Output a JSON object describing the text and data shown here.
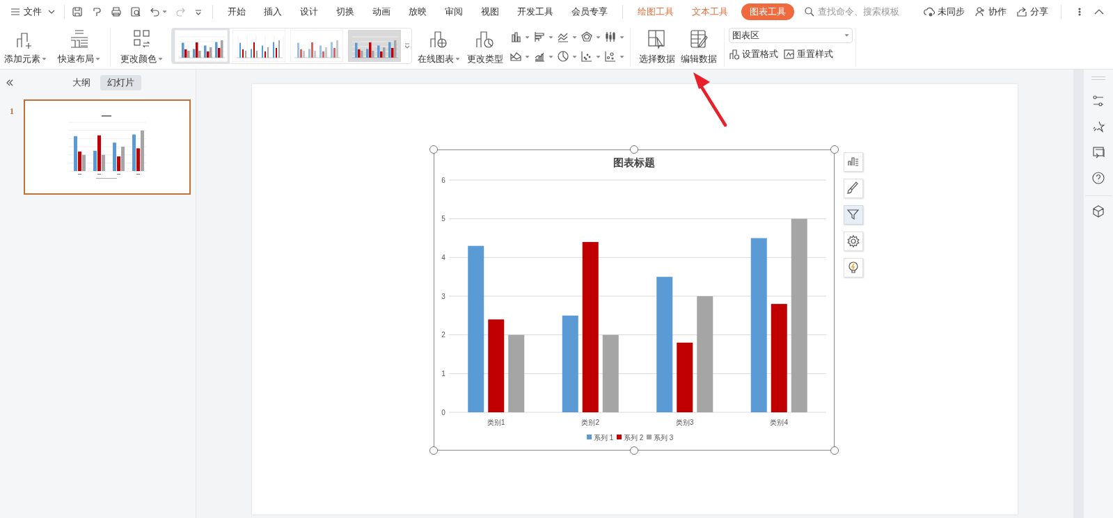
{
  "menu_bar": {
    "file_menu": "文件",
    "tabs": [
      {
        "label": "开始",
        "kind": "main",
        "selected": false
      },
      {
        "label": "插入",
        "kind": "main",
        "selected": false
      },
      {
        "label": "设计",
        "kind": "main",
        "selected": false
      },
      {
        "label": "切换",
        "kind": "main",
        "selected": false
      },
      {
        "label": "动画",
        "kind": "main",
        "selected": false
      },
      {
        "label": "放映",
        "kind": "main",
        "selected": false
      },
      {
        "label": "审阅",
        "kind": "main",
        "selected": false
      },
      {
        "label": "视图",
        "kind": "main",
        "selected": false
      },
      {
        "label": "开发工具",
        "kind": "main",
        "selected": false
      },
      {
        "label": "会员专享",
        "kind": "main",
        "selected": false
      },
      {
        "label": "绘图工具",
        "kind": "context",
        "selected": false
      },
      {
        "label": "文本工具",
        "kind": "context",
        "selected": false
      },
      {
        "label": "图表工具",
        "kind": "context",
        "selected": true
      }
    ],
    "search": {
      "placeholder": "查找命令、搜索模板"
    },
    "actions": [
      {
        "label": "未同步",
        "kind": "sync"
      },
      {
        "label": "协作",
        "kind": "collaborate"
      },
      {
        "label": "分享",
        "kind": "share"
      }
    ]
  },
  "ribbon": {
    "left_buttons": [
      {
        "label": "添加元素",
        "kind": "add"
      },
      {
        "label": "快速布局",
        "kind": "layout"
      },
      {
        "label": "更改颜色",
        "kind": "colors"
      }
    ],
    "chart_styles": [
      {
        "kind": "plain",
        "selected": true
      },
      {
        "kind": "gridded",
        "selected": false
      },
      {
        "kind": "striped",
        "selected": false
      },
      {
        "kind": "shaded",
        "selected": false
      }
    ],
    "type_buttons": [
      {
        "label": "在线图表",
        "kind": "online"
      },
      {
        "label": "更改类型",
        "kind": "change"
      }
    ],
    "chart_types": [
      {
        "kind": "column"
      },
      {
        "kind": "bar"
      },
      {
        "kind": "line"
      },
      {
        "kind": "radar"
      },
      {
        "kind": "stock"
      },
      {
        "kind": "area"
      },
      {
        "kind": "combo"
      },
      {
        "kind": "pie"
      },
      {
        "kind": "scatter"
      },
      {
        "kind": "bubble"
      }
    ],
    "data_buttons": [
      {
        "label": "选择数据",
        "kind": "select"
      },
      {
        "label": "编辑数据",
        "kind": "edit"
      }
    ],
    "element_select": {
      "value": "图表区"
    },
    "format_buttons": [
      {
        "label": "设置格式",
        "kind": "format"
      },
      {
        "label": "重置样式",
        "kind": "reset"
      }
    ]
  },
  "panel": {
    "tabs": [
      {
        "label": "大纲",
        "selected": false
      },
      {
        "label": "幻灯片",
        "selected": true
      }
    ],
    "slides": [
      {
        "number": "1",
        "selected": true
      }
    ]
  },
  "chart": {
    "chart_data": {
      "type": "bar",
      "title": "图表标题",
      "categories": [
        "类别1",
        "类别2",
        "类别3",
        "类别4"
      ],
      "series": [
        {
          "name": "系列 1",
          "color": "#5b9bd5",
          "values": [
            4.3,
            2.5,
            3.5,
            4.5
          ]
        },
        {
          "name": "系列 2",
          "color": "#c00000",
          "values": [
            2.4,
            4.4,
            1.8,
            2.8
          ]
        },
        {
          "name": "系列 3",
          "color": "#a5a5a5",
          "values": [
            2,
            2,
            3,
            5
          ]
        }
      ],
      "ylim": [
        0,
        6
      ],
      "yticks": [
        {
          "value": 0,
          "label": "0"
        },
        {
          "value": 1,
          "label": "1"
        },
        {
          "value": 2,
          "label": "2"
        },
        {
          "value": 3,
          "label": "3"
        },
        {
          "value": 4,
          "label": "4"
        },
        {
          "value": 5,
          "label": "5"
        },
        {
          "value": 6,
          "label": "6"
        }
      ],
      "grid": true,
      "legend": true
    }
  },
  "chart_tools": [
    {
      "kind": "elements",
      "selected": false
    },
    {
      "kind": "style",
      "selected": false
    },
    {
      "kind": "filter",
      "selected": true
    },
    {
      "kind": "settings",
      "selected": false
    },
    {
      "kind": "ideas",
      "selected": false
    }
  ]
}
